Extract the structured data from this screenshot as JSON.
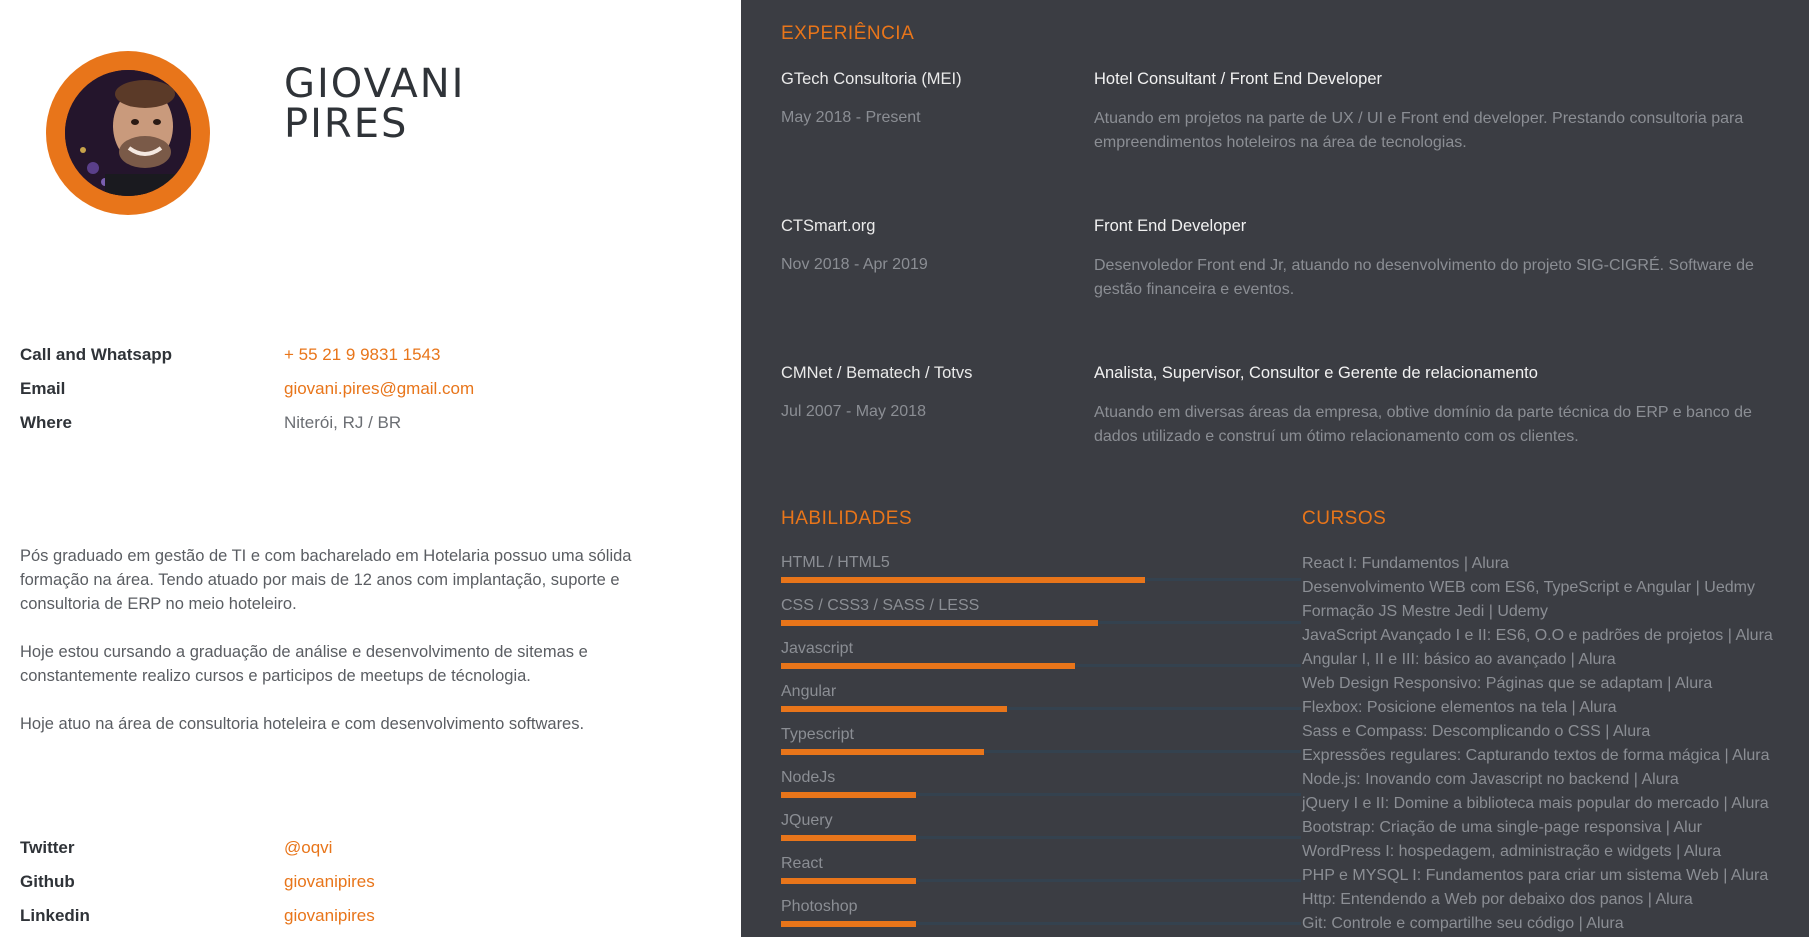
{
  "profile": {
    "first_name": "GIOVANI",
    "last_name": "PIRES"
  },
  "contact": [
    {
      "label": "Call and Whatsapp",
      "value": "+ 55 21 9 9831 1543",
      "link": true
    },
    {
      "label": "Email",
      "value": "giovani.pires@gmail.com",
      "link": true
    },
    {
      "label": "Where",
      "value": "Niterói, RJ / BR",
      "link": false
    }
  ],
  "about": [
    "Pós graduado em gestão de TI e com bacharelado em Hotelaria possuo uma sólida formação na área. Tendo atuado por mais de 12 anos com implantação, suporte e consultoria de ERP no meio hoteleiro.",
    "Hoje estou cursando a graduação de análise e desenvolvimento de sitemas e constantemente realizo cursos e participos de meetups de técnologia.",
    "Hoje atuo na área de consultoria hoteleira e com desenvolvimento softwares."
  ],
  "social": [
    {
      "label": "Twitter",
      "value": "@oqvi"
    },
    {
      "label": "Github",
      "value": "giovanipires"
    },
    {
      "label": "Linkedin",
      "value": "giovanipires"
    }
  ],
  "experience": {
    "title": "EXPERIÊNCIA",
    "jobs": [
      {
        "company": "GTech Consultoria (MEI)",
        "dates": "May 2018 - Present",
        "role": "Hotel Consultant / Front End Developer",
        "description": "Atuando em projetos na parte de UX / UI e Front end developer. Prestando consultoria para empreendimentos hoteleiros na área de tecnologias."
      },
      {
        "company": "CTSmart.org",
        "dates": "Nov 2018 - Apr 2019",
        "role": "Front End Developer",
        "description": "Desenvoledor Front end Jr, atuando no desenvolvimento do projeto SIG-CIGRÉ. Software de gestão financeira e eventos."
      },
      {
        "company": "CMNet / Bematech / Totvs",
        "dates": "Jul 2007 - May 2018",
        "role": "Analista, Supervisor, Consultor e Gerente de relacionamento",
        "description": "Atuando em diversas áreas da empresa, obtive domínio da parte técnica do ERP e banco de dados utilizado e construí um ótimo relacionamento com os clientes."
      }
    ]
  },
  "skills": {
    "title": "HABILIDADES",
    "items": [
      {
        "name": "HTML / HTML5",
        "level": 0.7
      },
      {
        "name": "CSS / CSS3 / SASS / LESS",
        "level": 0.61
      },
      {
        "name": "Javascript",
        "level": 0.565
      },
      {
        "name": "Angular",
        "level": 0.435
      },
      {
        "name": "Typescript",
        "level": 0.39
      },
      {
        "name": "NodeJs",
        "level": 0.26
      },
      {
        "name": "JQuery",
        "level": 0.26
      },
      {
        "name": "React",
        "level": 0.26
      },
      {
        "name": "Photoshop",
        "level": 0.26
      }
    ]
  },
  "courses": {
    "title": "CURSOS",
    "items": [
      "React I: Fundamentos | Alura",
      "Desenvolvimento WEB com ES6, TypeScript e Angular | Uedmy",
      "Formação JS Mestre Jedi | Udemy",
      "JavaScript Avançado I e II: ES6, O.O e padrões de projetos | Alura",
      "Angular I, II e III: básico ao avançado | Alura",
      "Web Design Responsivo: Páginas que se adaptam | Alura",
      "Flexbox: Posicione elementos na tela | Alura",
      "Sass e Compass: Descomplicando o CSS | Alura",
      "Expressões regulares: Capturando textos de forma mágica | Alura",
      "Node.js: Inovando com Javascript no backend | Alura",
      "jQuery I e II: Domine a biblioteca mais popular do mercado | Alura",
      "Bootstrap: Criação de uma single-page responsiva | Alur",
      "WordPress I: hospedagem, administração e widgets | Alura",
      "PHP e MYSQL I: Fundamentos para criar um sistema Web | Alura",
      "Http: Entendendo a Web por debaixo dos panos | Alura",
      "Git: Controle e compartilhe seu código | Alura"
    ]
  },
  "colors": {
    "accent": "#e8751a",
    "dark_panel": "#3b3d43",
    "track": "#34424f"
  }
}
